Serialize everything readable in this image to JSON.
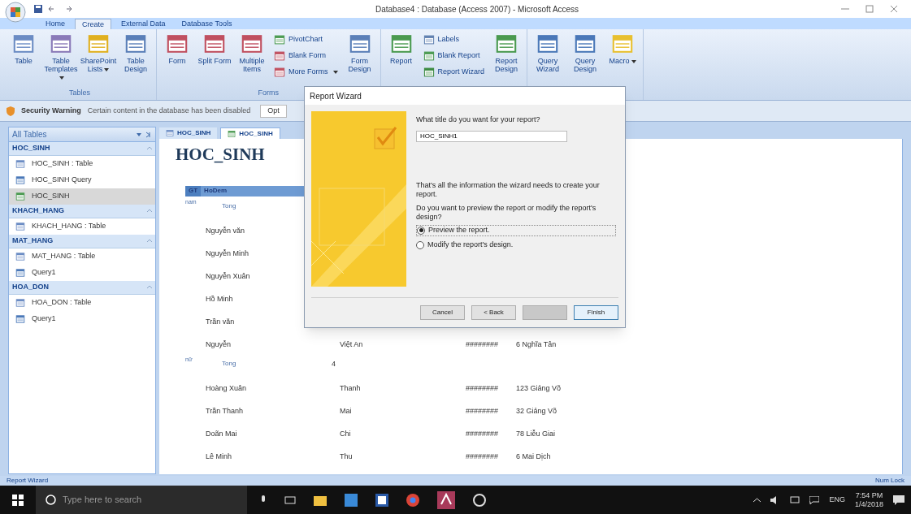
{
  "window": {
    "title": "Database4 : Database (Access 2007) - Microsoft Access"
  },
  "ribbon_tabs": [
    {
      "label": "Home",
      "selected": false
    },
    {
      "label": "Create",
      "selected": true
    },
    {
      "label": "External Data",
      "selected": false
    },
    {
      "label": "Database Tools",
      "selected": false
    }
  ],
  "ribbon_groups": [
    {
      "label": "Tables",
      "items": [
        {
          "label": "Table",
          "kind": "large",
          "menu": false
        },
        {
          "label": "Table Templates",
          "kind": "large",
          "menu": true
        },
        {
          "label": "SharePoint Lists",
          "kind": "large",
          "menu": true
        },
        {
          "label": "Table Design",
          "kind": "large",
          "menu": false
        }
      ]
    },
    {
      "label": "Forms",
      "items": [
        {
          "label": "Form",
          "kind": "large",
          "menu": false
        },
        {
          "label": "Split Form",
          "kind": "large",
          "menu": false
        },
        {
          "label": "Multiple Items",
          "kind": "large",
          "menu": false
        },
        {
          "label": "PivotChart",
          "kind": "small",
          "menu": false
        },
        {
          "label": "Blank Form",
          "kind": "small",
          "menu": false
        },
        {
          "label": "More Forms",
          "kind": "small",
          "menu": true
        },
        {
          "label": "Form Design",
          "kind": "large",
          "menu": false
        }
      ]
    },
    {
      "items": [
        {
          "label": "Report",
          "kind": "large",
          "menu": false
        },
        {
          "label": "Labels",
          "kind": "small",
          "menu": false
        },
        {
          "label": "Blank Report",
          "kind": "small",
          "menu": false
        },
        {
          "label": "Report Wizard",
          "kind": "small",
          "menu": false
        },
        {
          "label": "Report Design",
          "kind": "large",
          "menu": false
        }
      ]
    },
    {
      "items": [
        {
          "label": "Query Wizard",
          "kind": "large",
          "menu": false
        },
        {
          "label": "Query Design",
          "kind": "large",
          "menu": false
        },
        {
          "label": "Macro",
          "kind": "large",
          "menu": true
        }
      ]
    }
  ],
  "security_bar": {
    "title": "Security Warning",
    "message": "Certain content in the database has been disabled",
    "button": "Opt"
  },
  "nav_pane": {
    "title": "All Tables",
    "groups": [
      {
        "label": "HOC_SINH",
        "items": [
          {
            "label": "HOC_SINH : Table",
            "kind": "table",
            "selected": false
          },
          {
            "label": "HOC_SINH Query",
            "kind": "query",
            "selected": false
          },
          {
            "label": "HOC_SINH",
            "kind": "report",
            "selected": true
          }
        ]
      },
      {
        "label": "KHACH_HANG",
        "items": [
          {
            "label": "KHACH_HANG : Table",
            "kind": "table",
            "selected": false
          }
        ]
      },
      {
        "label": "MAT_HANG",
        "items": [
          {
            "label": "MAT_HANG : Table",
            "kind": "table",
            "selected": false
          },
          {
            "label": "Query1",
            "kind": "query",
            "selected": false
          }
        ]
      },
      {
        "label": "HOA_DON",
        "items": [
          {
            "label": "HOA_DON : Table",
            "kind": "table",
            "selected": false
          },
          {
            "label": "Query1",
            "kind": "query",
            "selected": false
          }
        ]
      }
    ]
  },
  "doc_tabs": [
    {
      "label": "HOC_SINH",
      "kind": "table",
      "selected": false
    },
    {
      "label": "HOC_SINH",
      "kind": "report",
      "selected": true
    }
  ],
  "report": {
    "title": "HOC_SINH",
    "columns": [
      "GT",
      "HoDem"
    ],
    "groups": [
      {
        "label": "nam",
        "total_label": "Tong",
        "rows": [
          {
            "cells": [
              "Nguyễn văn"
            ]
          },
          {
            "cells": [
              "Nguyễn Minh"
            ]
          },
          {
            "cells": [
              "Nguyễn Xuân"
            ]
          },
          {
            "cells": [
              "Hồ Minh"
            ]
          },
          {
            "cells": [
              "Trần văn"
            ]
          },
          {
            "cells": [
              "Nguyễn",
              "Việt An",
              "########",
              "6 Nghĩa Tân"
            ]
          }
        ]
      },
      {
        "label": "nữ",
        "total_label": "Tong",
        "total_value": "4",
        "rows": [
          {
            "cells": [
              "Hoàng Xuân",
              "Thanh",
              "########",
              "123 Giảng Võ"
            ]
          },
          {
            "cells": [
              "Trần Thanh",
              "Mai",
              "########",
              "32 Giảng Võ"
            ]
          },
          {
            "cells": [
              "Doãn Mai",
              "Chi",
              "########",
              "78 Liễu Giai"
            ]
          },
          {
            "cells": [
              "Lê Minh",
              "Thu",
              "########",
              "6 Mai Dịch"
            ]
          }
        ]
      }
    ]
  },
  "wizard": {
    "title": "Report Wizard",
    "question": "What title do you want for your report?",
    "value": "HOC_SINH1",
    "info": "That's all the information the wizard needs to create your report.",
    "prompt": "Do you want to preview the report or modify the report's design?",
    "options": [
      {
        "label": "Preview the report.",
        "selected": true
      },
      {
        "label": "Modify the report's design.",
        "selected": false
      }
    ],
    "buttons": [
      {
        "label": "Cancel",
        "disabled": false,
        "default": false
      },
      {
        "label": "< Back",
        "disabled": false,
        "default": false
      },
      {
        "disabled": true,
        "default": false
      },
      {
        "label": "Finish",
        "disabled": false,
        "default": true
      }
    ]
  },
  "status_bar": {
    "left": "Report Wizard",
    "right": "Num Lock"
  },
  "taskbar": {
    "search_placeholder": "Type here to search",
    "language": "ENG",
    "time": "7:54 PM",
    "date": "1/4/2018"
  }
}
